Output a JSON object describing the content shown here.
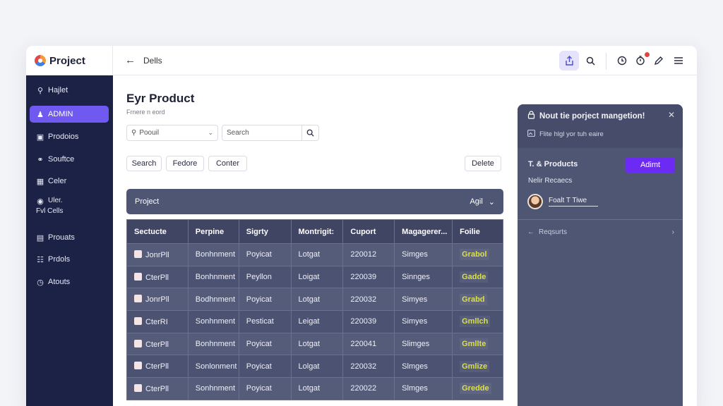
{
  "app": {
    "name": "Project"
  },
  "header": {
    "breadcrumb": "Dells"
  },
  "sidebar": {
    "items": [
      {
        "label": "Hajlet",
        "icon": "search-icon"
      },
      {
        "label": "ADMIN",
        "icon": "user-icon",
        "active": true
      },
      {
        "label": "Prodoios",
        "icon": "box-icon"
      },
      {
        "label": "Souftce",
        "icon": "link-icon"
      },
      {
        "label": "Celer",
        "icon": "calendar-icon"
      },
      {
        "label": "Uler.",
        "label2": "Fvl Cells",
        "icon": "location-icon"
      },
      {
        "label": "Prouats",
        "icon": "folder-icon"
      },
      {
        "label": "Prdols",
        "icon": "file-icon"
      },
      {
        "label": "Atouts",
        "icon": "clock-icon"
      }
    ]
  },
  "main": {
    "title": "Eyr Product",
    "subtitle": "Frnere n eord",
    "select_value": "Poouil",
    "search_placeholder": "Search",
    "filters": [
      "Search",
      "Fedore",
      "Conter"
    ],
    "delete_label": "Delete",
    "project_bar": {
      "label": "Project",
      "right_label": "Agil"
    }
  },
  "table": {
    "columns": [
      "Sectucte",
      "Perpine",
      "Sigrty",
      "Montrigit:",
      "Cuport",
      "Magagerer...",
      "Foilie"
    ],
    "rows": [
      [
        "JonrPll",
        "Bonhnment",
        "Poyicat",
        "Lotgat",
        "220012",
        "Simges",
        "Grabol"
      ],
      [
        "CterPll",
        "Bonhnment",
        "Peyllon",
        "Loigat",
        "220039",
        "Sinnges",
        "Gadde"
      ],
      [
        "JonrPll",
        "Bodhnment",
        "Poyicat",
        "Lotgat",
        "220032",
        "Simyes",
        "Grabd"
      ],
      [
        "CterRI",
        "Sonhnment",
        "Pesticat",
        "Leigat",
        "220039",
        "Simyes",
        "Gmllch"
      ],
      [
        "CterPll",
        "Bonhnment",
        "Poyicat",
        "Lotgat",
        "220041",
        "Slimges",
        "Gmllte"
      ],
      [
        "CterPll",
        "Sonlonment",
        "Poyicat",
        "Lolgat",
        "220032",
        "Slmges",
        "Gmlize"
      ],
      [
        "CterPll",
        "Sonhnment",
        "Poyicat",
        "Lotgat",
        "220022",
        "Slmges",
        "Gredde"
      ]
    ],
    "status_color": "#d9e04a"
  },
  "panel": {
    "title": "Nout tie porject mangetion!",
    "subtitle": "Flite hlgl yor tuh eaire",
    "products_label": "T. & Products",
    "admin_button": "Adimt",
    "name_label": "Nelir Recaecs",
    "user_label": "Foalt T Tiwe",
    "footer_label": "Reqsurts"
  },
  "colors": {
    "accent": "#6f59f0",
    "sidebar": "#1c2146",
    "panel": "#4f5674",
    "admin_button": "#6b2bf2"
  }
}
